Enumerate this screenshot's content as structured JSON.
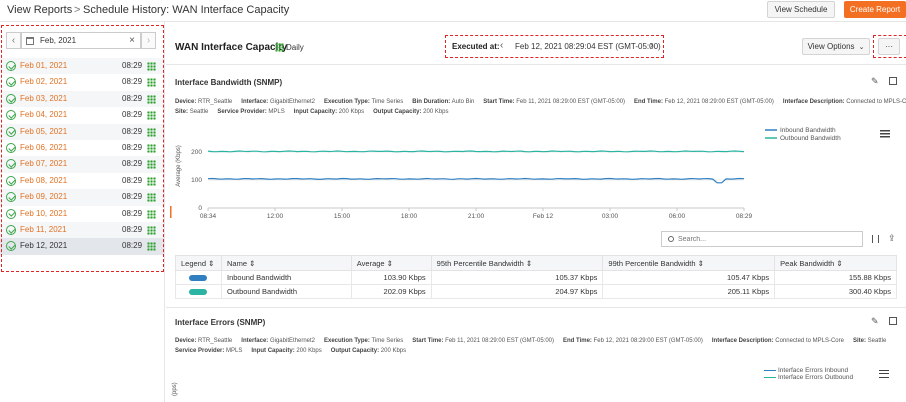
{
  "header": {
    "crumb_root": "View Reports",
    "crumb_sep": ">",
    "crumb_current": "Schedule History: WAN Interface Capacity",
    "view_schedule": "View Schedule",
    "create_report": "Create Report"
  },
  "sidebar": {
    "month": "Feb, 2021",
    "clear": "×",
    "prev": "‹",
    "next": "›",
    "items": [
      {
        "date": "Feb 01, 2021",
        "time": "08:29"
      },
      {
        "date": "Feb 02, 2021",
        "time": "08:29"
      },
      {
        "date": "Feb 03, 2021",
        "time": "08:29"
      },
      {
        "date": "Feb 04, 2021",
        "time": "08:29"
      },
      {
        "date": "Feb 05, 2021",
        "time": "08:29"
      },
      {
        "date": "Feb 06, 2021",
        "time": "08:29"
      },
      {
        "date": "Feb 07, 2021",
        "time": "08:29"
      },
      {
        "date": "Feb 08, 2021",
        "time": "08:29"
      },
      {
        "date": "Feb 09, 2021",
        "time": "08:29"
      },
      {
        "date": "Feb 10, 2021",
        "time": "08:29"
      },
      {
        "date": "Feb 11, 2021",
        "time": "08:29"
      },
      {
        "date": "Feb 12, 2021",
        "time": "08:29"
      }
    ],
    "selected_index": 11
  },
  "report": {
    "title": "WAN Interface Capacity",
    "frequency": "Daily",
    "executed_label": "Executed at:",
    "executed_value": "Feb 12, 2021 08:29:04 EST (GMT-05:00)",
    "view_options": "View Options",
    "more": "···"
  },
  "bandwidth": {
    "title": "Interface Bandwidth (SNMP)",
    "meta_line1": [
      {
        "k": "Device:",
        "v": "RTR_Seattle"
      },
      {
        "k": "Interface:",
        "v": "GigabitEthernet2"
      },
      {
        "k": "Execution Type:",
        "v": "Time Series"
      },
      {
        "k": "Bin Duration:",
        "v": "Auto Bin"
      },
      {
        "k": "Start Time:",
        "v": "Feb 11, 2021 08:29:00 EST (GMT-05:00)"
      },
      {
        "k": "End Time:",
        "v": "Feb 12, 2021 08:29:00 EST (GMT-05:00)"
      },
      {
        "k": "Interface Description:",
        "v": "Connected to MPLS-Core"
      }
    ],
    "meta_line2": [
      {
        "k": "Site:",
        "v": "Seattle"
      },
      {
        "k": "Service Provider:",
        "v": "MPLS"
      },
      {
        "k": "Input Capacity:",
        "v": "200 Kbps"
      },
      {
        "k": "Output Capacity:",
        "v": "200 Kbps"
      }
    ],
    "search_placeholder": "Search...",
    "table": {
      "headers": [
        "Legend",
        "Name",
        "Average",
        "95th Percentile Bandwidth",
        "99th Percentile Bandwidth",
        "Peak Bandwidth"
      ],
      "rows": [
        {
          "color": "#2f7fc1",
          "name": "Inbound Bandwidth",
          "avg": "103.90 Kbps",
          "p95": "105.37 Kbps",
          "p99": "105.47 Kbps",
          "peak": "155.88 Kbps"
        },
        {
          "color": "#2bb3a3",
          "name": "Outbound Bandwidth",
          "avg": "202.09 Kbps",
          "p95": "204.97 Kbps",
          "p99": "205.11 Kbps",
          "peak": "300.40 Kbps"
        }
      ]
    }
  },
  "chart_data": {
    "type": "line",
    "ylabel": "Average (Kbps)",
    "yticks": [
      0,
      100,
      200
    ],
    "ylim": [
      0,
      300
    ],
    "xticks": [
      "08:34",
      "12:00",
      "15:00",
      "18:00",
      "21:00",
      "Feb 12",
      "03:00",
      "06:00",
      "08:29"
    ],
    "legend_position": "top-right",
    "series": [
      {
        "name": "Inbound Bandwidth",
        "color": "#2f7fc1",
        "level": 103.9,
        "dip_at_fraction": 0.955,
        "dip_value": 90
      },
      {
        "name": "Outbound Bandwidth",
        "color": "#2bb3a3",
        "level": 202.1
      }
    ]
  },
  "errors": {
    "title": "Interface Errors (SNMP)",
    "meta_line1": [
      {
        "k": "Device:",
        "v": "RTR_Seattle"
      },
      {
        "k": "Interface:",
        "v": "GigabitEthernet2"
      },
      {
        "k": "Execution Type:",
        "v": "Time Series"
      },
      {
        "k": "Start Time:",
        "v": "Feb 11, 2021 08:29:00 EST (GMT-05:00)"
      },
      {
        "k": "End Time:",
        "v": "Feb 12, 2021 08:29:00 EST (GMT-05:00)"
      },
      {
        "k": "Interface Description:",
        "v": "Connected to MPLS-Core"
      },
      {
        "k": "Site:",
        "v": "Seattle"
      }
    ],
    "meta_line2": [
      {
        "k": "Service Provider:",
        "v": "MPLS"
      },
      {
        "k": "Input Capacity:",
        "v": "200 Kbps"
      },
      {
        "k": "Output Capacity:",
        "v": "200 Kbps"
      }
    ],
    "legend": [
      {
        "name": "Interface Errors Inbound",
        "color": "#2f7fc1"
      },
      {
        "name": "Interface Errors Outbound",
        "color": "#2bb3a3"
      }
    ],
    "ylabel_fragment": "(pps)"
  },
  "icons": {
    "edit": "pencil-icon",
    "export": "export-icon",
    "menu": "hamburger-icon",
    "calendar": "calendar-icon",
    "columns": "columns-icon",
    "share": "share-icon"
  }
}
